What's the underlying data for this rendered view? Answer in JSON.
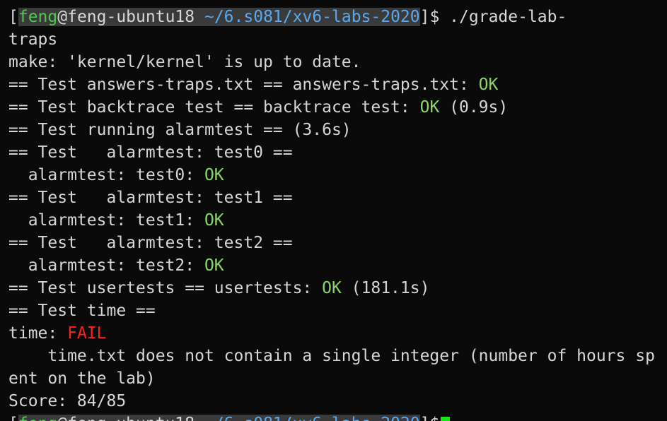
{
  "prompt": {
    "open_bracket": "[",
    "user": "feng",
    "at_host": "@feng-ubuntu18",
    "space": " ",
    "path": "~/6.s081/xv6-labs-2020",
    "close": "]$",
    "command": " ./grade-lab-",
    "command_wrap": "traps"
  },
  "output": {
    "make_line": "make: 'kernel/kernel' is up to date.",
    "test1_prefix": "== Test answers-traps.txt == answers-traps.txt: ",
    "test1_status": "OK",
    "test2_prefix": "== Test backtrace test == backtrace test: ",
    "test2_status": "OK",
    "test2_time": " (0.9s)",
    "test3": "== Test running alarmtest == (3.6s)",
    "test4": "== Test   alarmtest: test0 ==",
    "test4_result_prefix": "  alarmtest: test0: ",
    "test4_status": "OK",
    "test5": "== Test   alarmtest: test1 ==",
    "test5_result_prefix": "  alarmtest: test1: ",
    "test5_status": "OK",
    "test6": "== Test   alarmtest: test2 ==",
    "test6_result_prefix": "  alarmtest: test2: ",
    "test6_status": "OK",
    "test7_prefix": "== Test usertests == usertests: ",
    "test7_status": "OK",
    "test7_time": " (181.1s)",
    "test8": "== Test time ==",
    "time_prefix": "time: ",
    "time_status": "FAIL",
    "time_msg_line1": "    time.txt does not contain a single integer (number of hours sp",
    "time_msg_line2": "ent on the lab)",
    "score": "Score: 84/85"
  },
  "colors": {
    "background": "#0a0a0a",
    "text": "#d6d6d6",
    "user": "#4ec94e",
    "path": "#5aa8f0",
    "ok": "#8fd36b",
    "fail": "#ff1f1f",
    "cursor": "#19e619"
  }
}
